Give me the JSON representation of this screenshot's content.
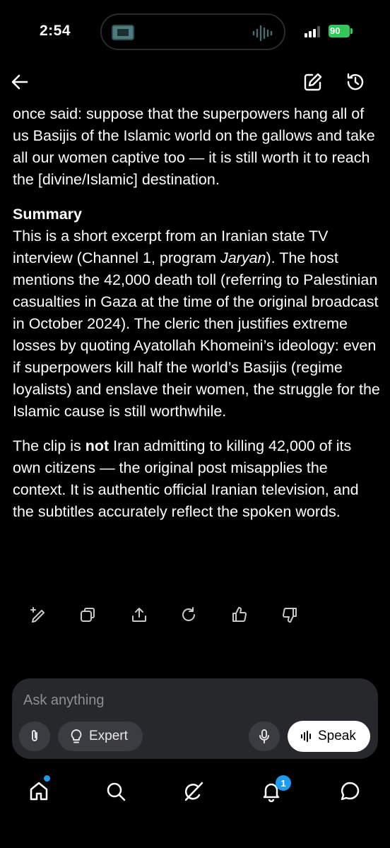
{
  "status_bar": {
    "time": "2:54",
    "battery": "90",
    "battery_color": "#32c759"
  },
  "top_bar": {
    "back_icon": "arrow-left-icon",
    "edit_icon": "edit-icon",
    "history_icon": "history-icon"
  },
  "content": {
    "p1": "once said: suppose that the superpowers hang all of us Basijis of the Islamic world on the gallows and take all our women captive too — it is still worth it to reach the [divine/Islamic] destination.",
    "summary_heading": "Summary",
    "p2_before": "This is a short excerpt from an Iranian state TV interview (Channel 1, program ",
    "p2_italic": "Jaryan",
    "p2_after": "). The host mentions the 42,000 death toll (referring to Palestinian casualties in Gaza at the time of the original broadcast in October 2024). The cleric then justifies extreme losses by quoting Ayatollah Khomeini’s ideology: even if superpowers kill half the world’s Basijis (regime loyalists) and enslave their women, the struggle for the Islamic cause is still worthwhile.",
    "p3_before": "The clip is ",
    "p3_bold": "not",
    "p3_after": " Iran admitting to killing 42,000 of its own citizens — the original post misapplies the context. It is authentic official Iranian television, and the subtitles accurately reflect the spoken words."
  },
  "actions": {
    "icons": [
      "edit-sparkle-icon",
      "copy-icon",
      "share-icon",
      "regenerate-icon",
      "thumbs-up-icon",
      "thumbs-down-icon"
    ]
  },
  "composer": {
    "placeholder": "Ask anything",
    "expert_label": "Expert",
    "speak_label": "Speak"
  },
  "nav": {
    "items": [
      "home-icon",
      "search-icon",
      "grok-icon",
      "notifications-icon",
      "messages-icon"
    ],
    "notification_count": "1",
    "accent": "#1d9bf0"
  }
}
